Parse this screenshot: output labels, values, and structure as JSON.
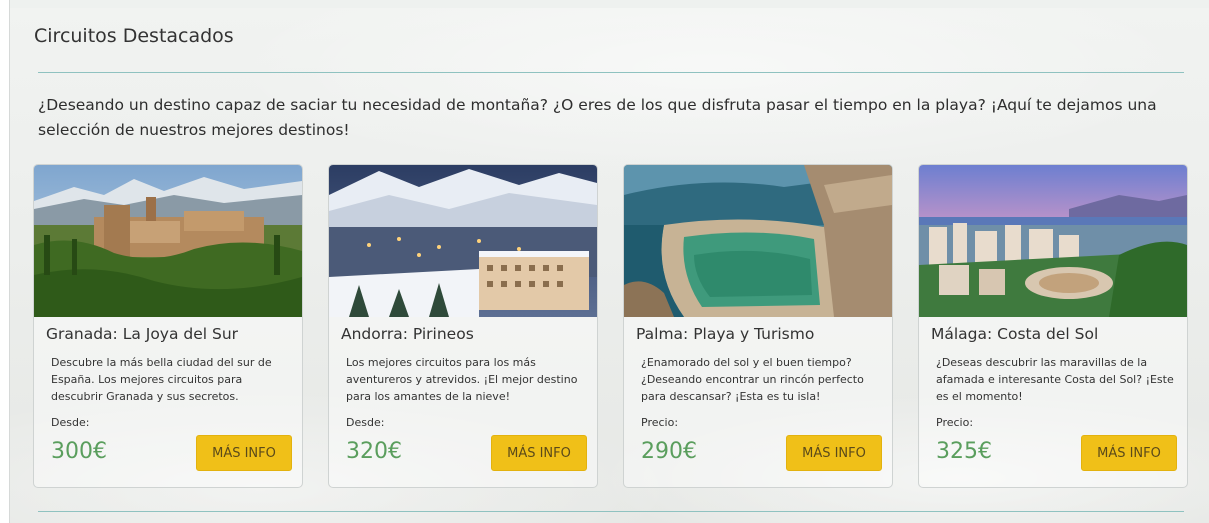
{
  "section": {
    "title": "Circuitos Destacados",
    "intro": "¿Deseando un destino capaz de saciar tu necesidad de montaña? ¿O eres de los que disfruta pasar el tiempo en la playa? ¡Aquí te dejamos una selección de nuestros mejores destinos!"
  },
  "cards": [
    {
      "title": "Granada: La Joya del Sur",
      "description": "Descubre la más bella ciudad del sur de España. Los mejores circuitos para descubrir Granada y sus secretos.",
      "price_label": "Desde:",
      "price": "300€",
      "button_label": "MÁS INFO"
    },
    {
      "title": "Andorra: Pirineos",
      "description": "Los mejores circuitos para los más aventureros y atrevidos. ¡El mejor destino para los amantes de la nieve!",
      "price_label": "Desde:",
      "price": "320€",
      "button_label": "MÁS INFO"
    },
    {
      "title": "Palma: Playa y Turismo",
      "description": "¿Enamorado del sol y el buen tiempo? ¿Deseando encontrar un rincón perfecto para descansar? ¡Esta es tu isla!",
      "price_label": "Precio:",
      "price": "290€",
      "button_label": "MÁS INFO"
    },
    {
      "title": "Málaga: Costa del Sol",
      "description": "¿Deseas descubrir las maravillas de la afamada e interesante Costa del Sol? ¡Este es el momento!",
      "price_label": "Precio:",
      "price": "325€",
      "button_label": "MÁS INFO"
    }
  ],
  "colors": {
    "accent_rule": "#8fc2c0",
    "price_green": "#5a9e5d",
    "button_yellow": "#f0c018"
  }
}
